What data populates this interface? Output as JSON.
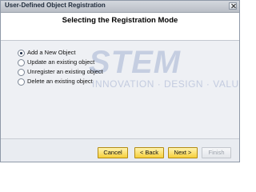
{
  "window": {
    "title": "User-Defined Object Registration"
  },
  "header": {
    "heading": "Selecting the Registration Mode"
  },
  "options": [
    {
      "label": "Add a New Object",
      "selected": true
    },
    {
      "label": "Update an existing object",
      "selected": false
    },
    {
      "label": "Unregister an existing object",
      "selected": false
    },
    {
      "label": "Delete an existing object",
      "selected": false
    }
  ],
  "watermark": {
    "logo": "STEM",
    "tagline": "INNOVATION · DESIGN · VALUE"
  },
  "buttons": {
    "cancel": "Cancel",
    "back": "< Back",
    "next": "Next >",
    "finish": "Finish"
  },
  "colors": {
    "button_gradient_top": "#fff3b0",
    "button_gradient_bottom": "#f6cf3c",
    "content_background": "#eef0f4"
  }
}
